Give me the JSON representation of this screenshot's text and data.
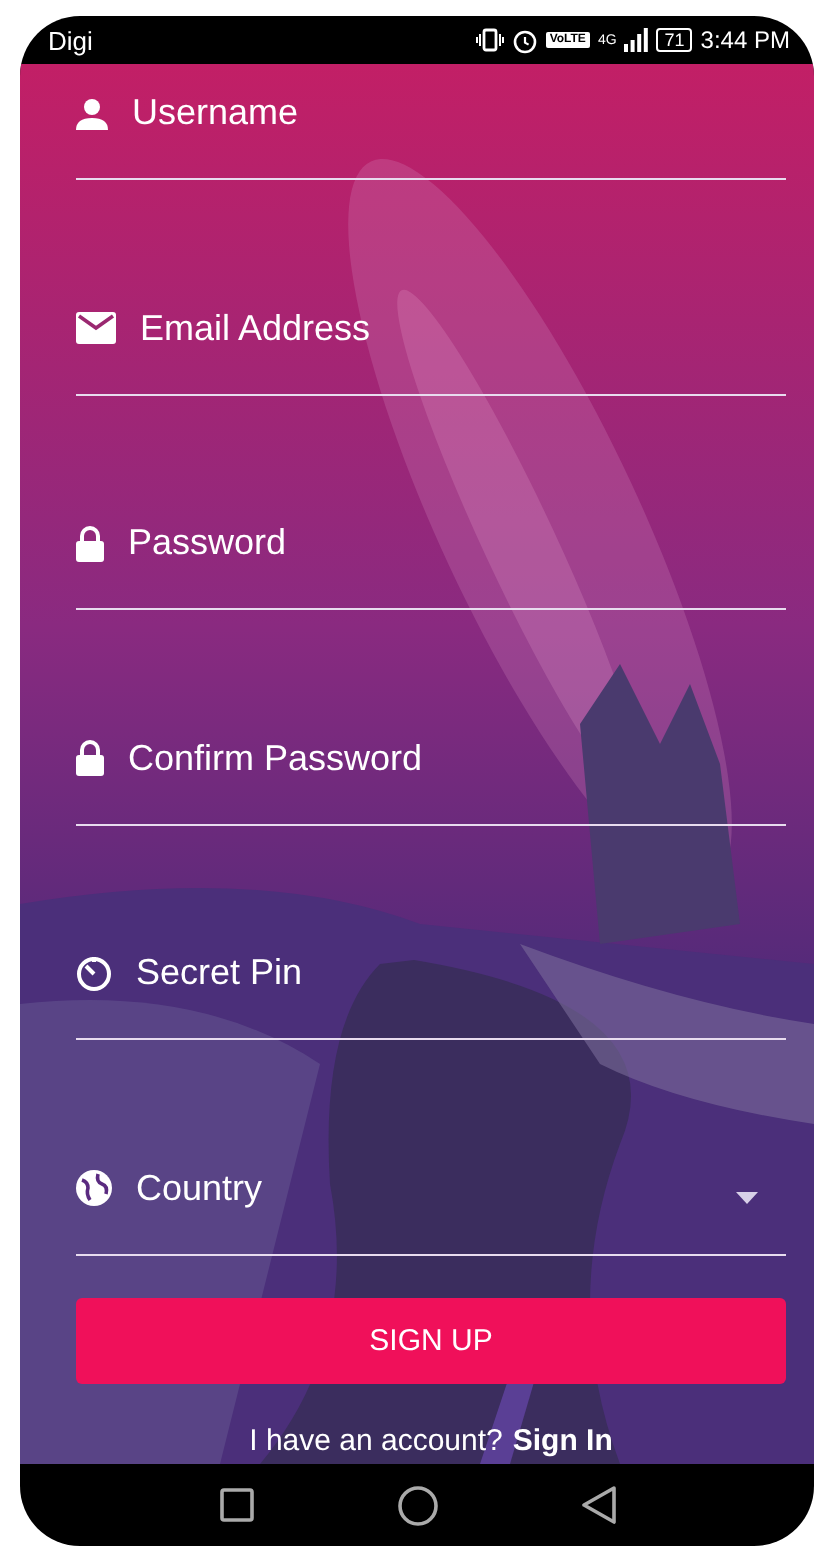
{
  "status_bar": {
    "carrier": "Digi",
    "volte": "VoLTE",
    "network": "4G",
    "battery": "71",
    "time": "3:44 PM"
  },
  "form": {
    "fields": [
      {
        "kind": "text",
        "placeholder": "Username"
      },
      {
        "kind": "email",
        "placeholder": "Email Address"
      },
      {
        "kind": "password",
        "placeholder": "Password"
      },
      {
        "kind": "password",
        "placeholder": "Confirm Password"
      },
      {
        "kind": "pin",
        "placeholder": "Secret Pin"
      },
      {
        "kind": "select",
        "placeholder": "Country"
      }
    ],
    "submit": "SIGN UP",
    "footer": {
      "prompt": "I have an account?",
      "link": "Sign In"
    }
  }
}
